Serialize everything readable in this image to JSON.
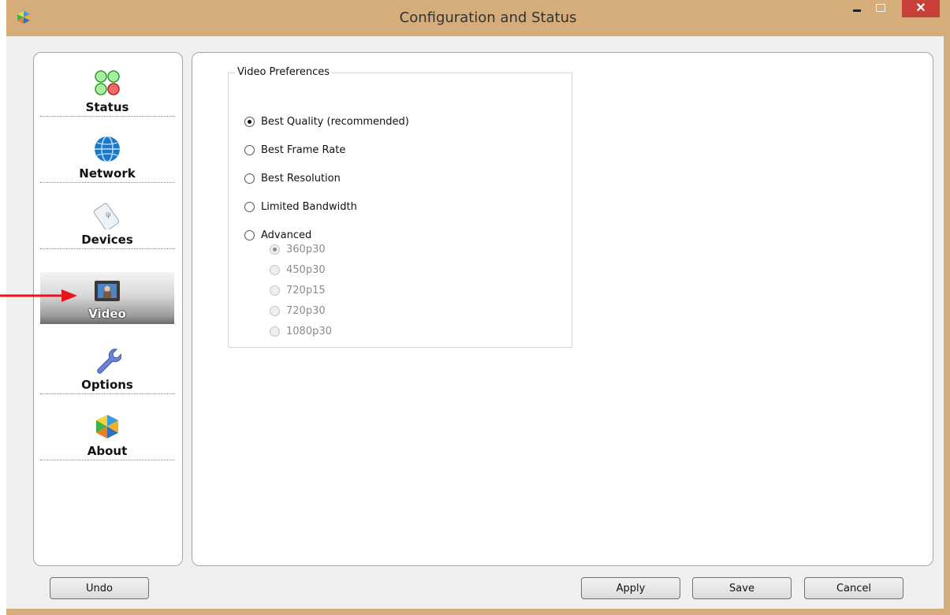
{
  "window": {
    "title": "Configuration and Status",
    "close_glyph": "✕"
  },
  "sidebar": {
    "items": [
      {
        "label": "Status",
        "icon": "status-lights-icon"
      },
      {
        "label": "Network",
        "icon": "globe-icon"
      },
      {
        "label": "Devices",
        "icon": "usb-device-icon"
      },
      {
        "label": "Video",
        "icon": "video-monitor-icon",
        "selected": true
      },
      {
        "label": "Options",
        "icon": "wrench-icon"
      },
      {
        "label": "About",
        "icon": "app-logo-icon"
      }
    ]
  },
  "video_preferences": {
    "title": "Video Preferences",
    "options": [
      {
        "label": "Best Quality (recommended)",
        "selected": true
      },
      {
        "label": "Best Frame Rate",
        "selected": false
      },
      {
        "label": "Best Resolution",
        "selected": false
      },
      {
        "label": "Limited Bandwidth",
        "selected": false
      },
      {
        "label": "Advanced",
        "selected": false
      }
    ],
    "advanced_options": [
      {
        "label": "360p30",
        "selected": true,
        "disabled": true
      },
      {
        "label": "450p30",
        "selected": false,
        "disabled": true
      },
      {
        "label": "720p15",
        "selected": false,
        "disabled": true
      },
      {
        "label": "720p30",
        "selected": false,
        "disabled": true
      },
      {
        "label": "1080p30",
        "selected": false,
        "disabled": true
      }
    ]
  },
  "buttons": {
    "undo": "Undo",
    "apply": "Apply",
    "save": "Save",
    "cancel": "Cancel"
  },
  "colors": {
    "title_bar": "#d4ad7a",
    "close": "#c7403a",
    "annotation_arrow": "#e8141b"
  }
}
